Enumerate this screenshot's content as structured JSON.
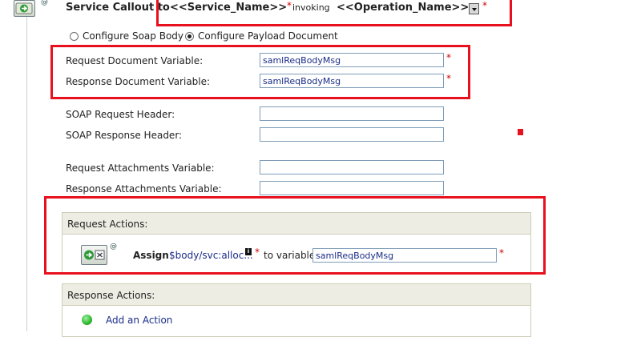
{
  "header": {
    "title": "Service Callout to",
    "service_name": "<<Service_Name>>",
    "invoking_label": "invoking",
    "operation_name": "<<Operation_Name>>",
    "required_mark": "*",
    "at_mark": "@"
  },
  "config_options": {
    "soap_body_label": "Configure Soap Body",
    "payload_doc_label": "Configure Payload Document",
    "selected": "payload_document"
  },
  "variables": {
    "request_doc_label": "Request Document Variable:",
    "request_doc_value": "samlReqBodyMsg",
    "response_doc_label": "Response Document Variable:",
    "response_doc_value": "samlReqBodyMsg",
    "soap_request_header_label": "SOAP Request Header:",
    "soap_request_header_value": "",
    "soap_response_header_label": "SOAP Response Header:",
    "soap_response_header_value": "",
    "request_attach_label": "Request Attachments Variable:",
    "request_attach_value": "",
    "response_attach_label": "Response Attachments Variable:",
    "response_attach_value": ""
  },
  "request_actions": {
    "label": "Request Actions:",
    "assign": {
      "keyword": "Assign",
      "expression": "$body/svc:alloc...",
      "info_icon": "i",
      "required_mark": "*",
      "to_variable_label": "to variable",
      "variable_value": "samlReqBodyMsg",
      "at_mark": "@"
    }
  },
  "response_actions": {
    "label": "Response Actions:",
    "add_action_label": "Add an Action"
  },
  "colors": {
    "highlight_red": "#e8101e",
    "link_blue": "#1a2c88",
    "section_bg": "#eeede3",
    "add_green": "#2db82d"
  }
}
